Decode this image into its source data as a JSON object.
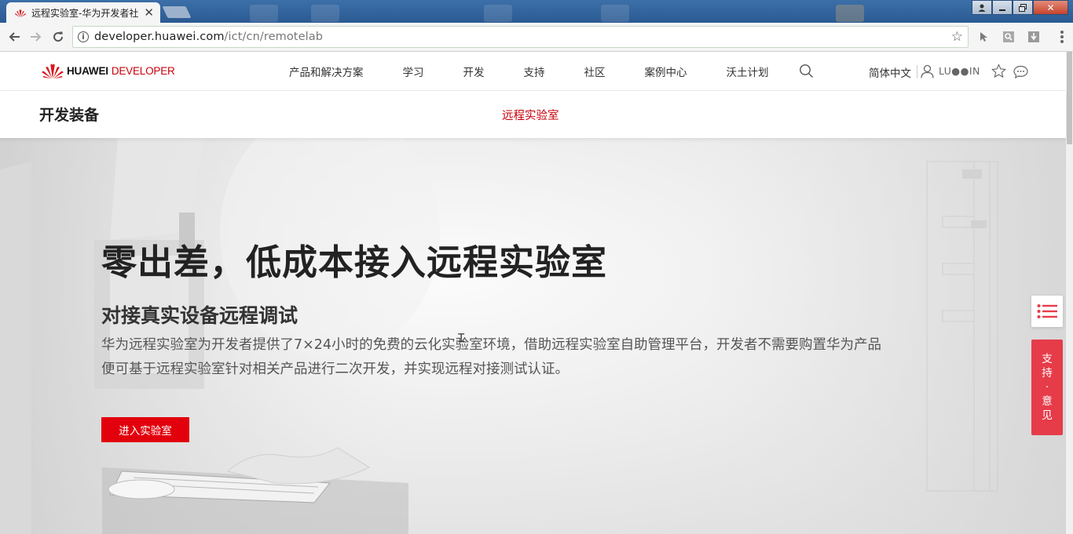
{
  "browser": {
    "tab": {
      "title": "远程实验室-华为开发者社区"
    },
    "url": {
      "host": "developer.huawei.com",
      "path": "/ict/cn/remotelab"
    }
  },
  "header": {
    "logo": {
      "brand": "HUAWEI",
      "product": "DEVELOPER"
    },
    "nav": [
      "产品和解决方案",
      "学习",
      "开发",
      "支持",
      "社区",
      "案例中心",
      "沃土计划"
    ],
    "language": "简体中文",
    "username": "LU●●IN"
  },
  "subnav": {
    "title": "开发装备",
    "active_link": "远程实验室"
  },
  "hero": {
    "title": "零出差，低成本接入远程实验室",
    "subtitle": "对接真实设备远程调试",
    "desc_line1": "华为远程实验室为开发者提供了7×24小时的免费的云化实验室环境，借助远程实验室自助管理平台，开发者不需要购置华为产品",
    "desc_line2": "便可基于远程实验室针对相关产品进行二次开发，并实现远程对接测试认证。",
    "cta": "进入实验室"
  },
  "floating": {
    "support_chars": [
      "支",
      "持",
      "·",
      "意",
      "见"
    ]
  },
  "colors": {
    "brand_red": "#c7000b",
    "cta_red": "#e2000d",
    "support_red": "#e63c4a"
  },
  "icons": [
    "huawei-flower-icon",
    "info-icon",
    "star-icon",
    "search-icon",
    "user-icon",
    "chat-icon",
    "list-icon"
  ]
}
